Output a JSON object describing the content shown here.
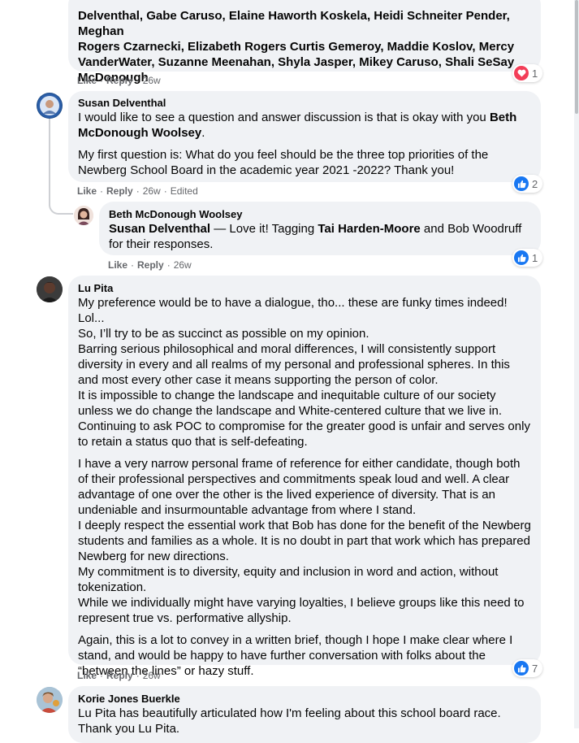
{
  "colors": {
    "bubble": "#f0f2f5",
    "muted": "#65676b",
    "like": "#1877f2",
    "love": "#f33e58"
  },
  "comments": [
    {
      "tail_lines": [
        "Delventhal, Gabe Caruso, Elaine Haworth Koskela, Heidi Schneiter Pender, Meghan",
        "Rogers Czarnecki, Elizabeth Rogers Curtis Gemeroy, Maddie Koslov, Mercy",
        "VanderWater, Suzanne Meenahan, Shyla Jasper, Mikey Caruso, Shali SeSay",
        "McDonough"
      ],
      "actions": {
        "like": "Like",
        "reply": "Reply",
        "time": "26w"
      },
      "reaction": {
        "icon": "heart-icon",
        "count": "1"
      }
    },
    {
      "author": "Susan Delventhal",
      "p1_pre": "I would like to see a question and answer discussion is that is okay with you ",
      "p1_mention": "Beth McDonough Woolsey",
      "p1_post": ".",
      "p2": "My first question is: What do you feel should be the three top priorities of the Newberg School Board in the academic year 2021 -2022? Thank you!",
      "actions": {
        "like": "Like",
        "reply": "Reply",
        "time": "26w",
        "edited": "Edited"
      },
      "reaction": {
        "icon": "thumbs-up-icon",
        "count": "2"
      }
    },
    {
      "author": "Beth McDonough Woolsey",
      "mention1": "Susan Delventhal",
      "text1": " — Love it! Tagging ",
      "mention2": "Tai Harden-Moore",
      "text2": " and Bob Woodruff for their responses.",
      "actions": {
        "like": "Like",
        "reply": "Reply",
        "time": "26w"
      },
      "reaction": {
        "icon": "thumbs-up-icon",
        "count": "1"
      }
    },
    {
      "author": "Lu Pita",
      "paragraphs": [
        "My preference would be to have a dialogue, tho... these are funky times indeed! Lol...\nSo, I’ll try to be as succinct as possible on my opinion.\nBarring serious philosophical and moral differences, I will consistently support diversity in every and all realms of my personal and professional spheres. In this and most every other case it means supporting the person of color.\nIt is impossible to change the landscape and inequitable culture of our society unless we do change the landscape and White-centered culture that we live in.\nContinuing to ask POC to compromise for the greater good is unfair and serves only to retain a status quo that is self-defeating.",
        "I have a very narrow personal frame of reference for either candidate, though both of their professional perspectives and commitments speak loud and well. A clear advantage of one over the other is the lived experience of diversity. That is an undeniable and insurmountable advantage from where I stand.\nI deeply respect the essential work that Bob has done for the benefit of the Newberg students and families as a whole. It is no doubt in part that work which has prepared Newberg for new directions.\nMy commitment is to diversity, equity and inclusion in word and action, without tokenization.\nWhile we individually might have varying loyalties, I believe groups like this need to represent true vs. performative allyship.",
        "Again, this is a lot to convey in a written brief, though I hope I make clear where I stand, and would be happy to have further conversation with folks about the “between the lines” or hazy stuff."
      ],
      "actions": {
        "like": "Like",
        "reply": "Reply",
        "time": "26w"
      },
      "reaction": {
        "icon": "thumbs-up-icon",
        "count": "7"
      }
    },
    {
      "author": "Korie Jones Buerkle",
      "text": "Lu Pita has beautifully articulated how I'm feeling about this school board race.\nThank you Lu Pita."
    }
  ]
}
